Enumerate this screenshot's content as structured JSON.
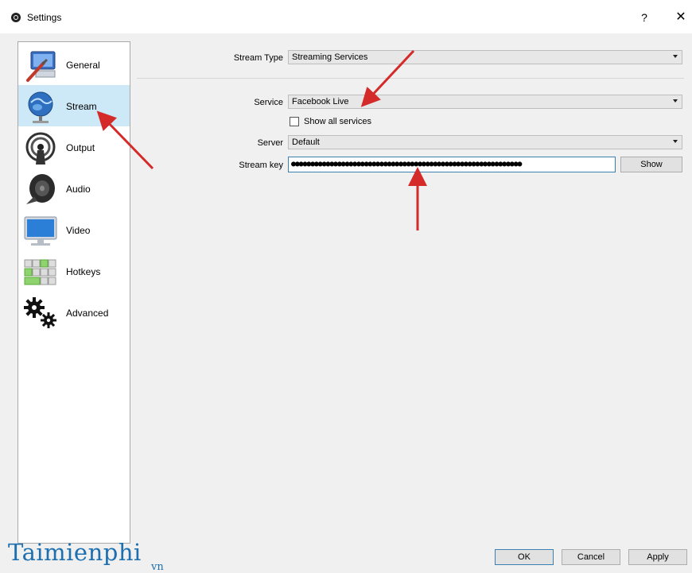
{
  "window": {
    "title": "Settings",
    "help": "?",
    "close": "✕"
  },
  "sidebar": {
    "items": [
      {
        "label": "General",
        "icon": "general-icon",
        "active": false
      },
      {
        "label": "Stream",
        "icon": "stream-globe-icon",
        "active": true
      },
      {
        "label": "Output",
        "icon": "output-broadcast-icon",
        "active": false
      },
      {
        "label": "Audio",
        "icon": "audio-speaker-icon",
        "active": false
      },
      {
        "label": "Video",
        "icon": "video-monitor-icon",
        "active": false
      },
      {
        "label": "Hotkeys",
        "icon": "hotkeys-keyboard-icon",
        "active": false
      },
      {
        "label": "Advanced",
        "icon": "advanced-gears-icon",
        "active": false
      }
    ]
  },
  "stream": {
    "type_label": "Stream Type",
    "type_value": "Streaming Services",
    "service_label": "Service",
    "service_value": "Facebook Live",
    "show_all_label": "Show all services",
    "show_all_checked": false,
    "server_label": "Server",
    "server_value": "Default",
    "key_label": "Stream key",
    "key_value": "●●●●●●●●●●●●●●●●●●●●●●●●●●●●●●●●●●●●●●●●●●●●●●●●●●●●●●●●●●●●",
    "show_button": "Show"
  },
  "footer": {
    "ok": "OK",
    "cancel": "Cancel",
    "apply": "Apply"
  },
  "watermark": {
    "main": "Taimienphi",
    "sub": "vn"
  },
  "colors": {
    "arrow": "#d42a2a",
    "selection": "#cde8f7",
    "focus": "#3c7fb1"
  }
}
